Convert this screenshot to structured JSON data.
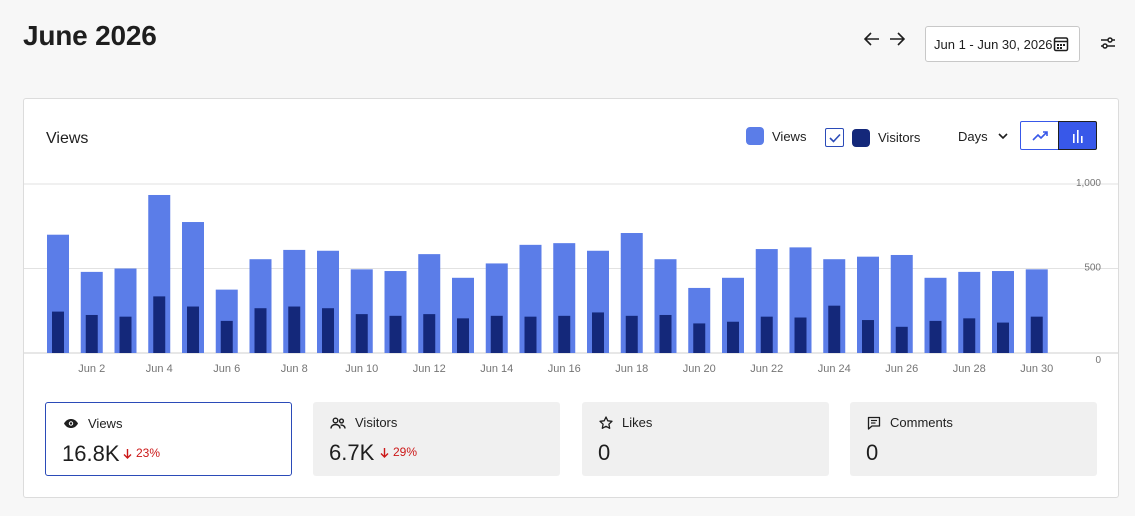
{
  "header": {
    "title": "June 2026",
    "prev_icon": "arrow-left-icon",
    "next_icon": "arrow-right-icon",
    "date_range": "Jun 1 - Jun 30, 2026",
    "calendar_icon": "calendar-icon",
    "settings_icon": "sliders-icon"
  },
  "card": {
    "title": "Views",
    "legend": {
      "views_label": "Views",
      "visitors_label": "Visitors",
      "visitors_checked": true
    },
    "period": "Days",
    "chart_modes": [
      "line-chart-icon",
      "bar-chart-icon"
    ],
    "active_mode": "bar"
  },
  "colors": {
    "views": "#5b7de8",
    "visitors": "#14287a",
    "accent": "#3858e9",
    "negative": "#cc1818"
  },
  "chart_data": {
    "type": "bar",
    "categories": [
      "Jun 1",
      "Jun 2",
      "Jun 3",
      "Jun 4",
      "Jun 5",
      "Jun 6",
      "Jun 7",
      "Jun 8",
      "Jun 9",
      "Jun 10",
      "Jun 11",
      "Jun 12",
      "Jun 13",
      "Jun 14",
      "Jun 15",
      "Jun 16",
      "Jun 17",
      "Jun 18",
      "Jun 19",
      "Jun 20",
      "Jun 21",
      "Jun 22",
      "Jun 23",
      "Jun 24",
      "Jun 25",
      "Jun 26",
      "Jun 27",
      "Jun 28",
      "Jun 29",
      "Jun 30"
    ],
    "tick_labels": [
      "Jun 2",
      "Jun 4",
      "Jun 6",
      "Jun 8",
      "Jun 10",
      "Jun 12",
      "Jun 14",
      "Jun 16",
      "Jun 18",
      "Jun 20",
      "Jun 22",
      "Jun 24",
      "Jun 26",
      "Jun 28",
      "Jun 30"
    ],
    "series": [
      {
        "name": "Views",
        "values": [
          700,
          480,
          500,
          935,
          775,
          375,
          555,
          610,
          605,
          495,
          485,
          585,
          445,
          530,
          640,
          650,
          605,
          710,
          555,
          385,
          445,
          615,
          625,
          555,
          570,
          580,
          445,
          480,
          485,
          495
        ]
      },
      {
        "name": "Visitors",
        "values": [
          245,
          225,
          215,
          335,
          275,
          190,
          265,
          275,
          265,
          230,
          220,
          230,
          205,
          220,
          215,
          220,
          240,
          220,
          225,
          175,
          185,
          215,
          210,
          280,
          195,
          155,
          190,
          205,
          180,
          215
        ]
      }
    ],
    "y_ticks": [
      "1,000",
      "500",
      "0"
    ],
    "ylim": [
      0,
      1000
    ],
    "grid": true
  },
  "tiles": [
    {
      "label": "Views",
      "icon": "eye-icon",
      "value": "16.8K",
      "change": "23%",
      "active": true
    },
    {
      "label": "Visitors",
      "icon": "people-icon",
      "value": "6.7K",
      "change": "29%",
      "active": false
    },
    {
      "label": "Likes",
      "icon": "star-icon",
      "value": "0",
      "change": "",
      "active": false
    },
    {
      "label": "Comments",
      "icon": "comment-icon",
      "value": "0",
      "change": "",
      "active": false
    }
  ]
}
